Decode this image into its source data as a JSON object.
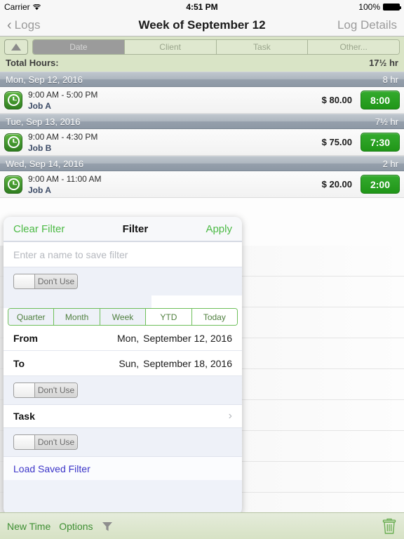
{
  "status_bar": {
    "carrier": "Carrier",
    "wifi_icon": "wifi-icon",
    "time": "4:51 PM",
    "battery_percent": "100%",
    "battery_icon": "battery-icon"
  },
  "nav_bar": {
    "back_icon": "chevron-left-icon",
    "back_label": "Logs",
    "title": "Week of September 12",
    "right_label": "Log Details"
  },
  "header": {
    "collapse_icon": "triangle-up-icon",
    "segments": [
      {
        "label": "Date",
        "selected": true
      },
      {
        "label": "Client",
        "selected": false
      },
      {
        "label": "Task",
        "selected": false
      },
      {
        "label": "Other...",
        "selected": false
      }
    ],
    "total_label": "Total Hours:",
    "total_value": "17½ hr"
  },
  "log_sections": [
    {
      "date": "Mon, Sep 12, 2016",
      "hours": "8 hr",
      "entries": [
        {
          "icon": "clock-icon",
          "time_range": "9:00 AM - 5:00 PM",
          "job": "Job A",
          "amount": "$ 80.00",
          "duration": "8:00"
        }
      ]
    },
    {
      "date": "Tue, Sep 13, 2016",
      "hours": "7½ hr",
      "entries": [
        {
          "icon": "clock-icon",
          "time_range": "9:00 AM - 4:30 PM",
          "job": "Job B",
          "amount": "$ 75.00",
          "duration": "7:30"
        }
      ]
    },
    {
      "date": "Wed, Sep 14, 2016",
      "hours": "2 hr",
      "entries": [
        {
          "icon": "clock-icon",
          "time_range": "9:00 AM - 11:00 AM",
          "job": "Job A",
          "amount": "$ 20.00",
          "duration": "2:00"
        }
      ]
    }
  ],
  "filter_popover": {
    "clear_label": "Clear Filter",
    "title": "Filter",
    "apply_label": "Apply",
    "name_placeholder": "Enter a name to save filter",
    "name_value": "",
    "switch_1_label": "Don't Use",
    "date_segments": [
      {
        "label": "Quarter",
        "tinted": true
      },
      {
        "label": "Month",
        "tinted": true
      },
      {
        "label": "Week",
        "tinted": true
      },
      {
        "label": "YTD",
        "tinted": false
      },
      {
        "label": "Today",
        "tinted": false
      }
    ],
    "from_label": "From",
    "from_dow": "Mon,",
    "from_date": "September 12, 2016",
    "to_label": "To",
    "to_dow": "Sun,",
    "to_date": "September 18, 2016",
    "switch_2_label": "Don't Use",
    "task_label": "Task",
    "task_chevron_icon": "chevron-right-icon",
    "switch_3_label": "Don't Use",
    "load_saved_label": "Load Saved Filter"
  },
  "toolbar": {
    "new_time_label": "New Time",
    "options_label": "Options",
    "filter_icon": "funnel-icon",
    "delete_icon": "trash-icon"
  },
  "colors": {
    "accent_green": "#4cba45",
    "badge_green": "#209618",
    "header_green": "#d9e4c6",
    "section_gray": "#9aa4b0",
    "link_blue": "#3b34c8"
  }
}
